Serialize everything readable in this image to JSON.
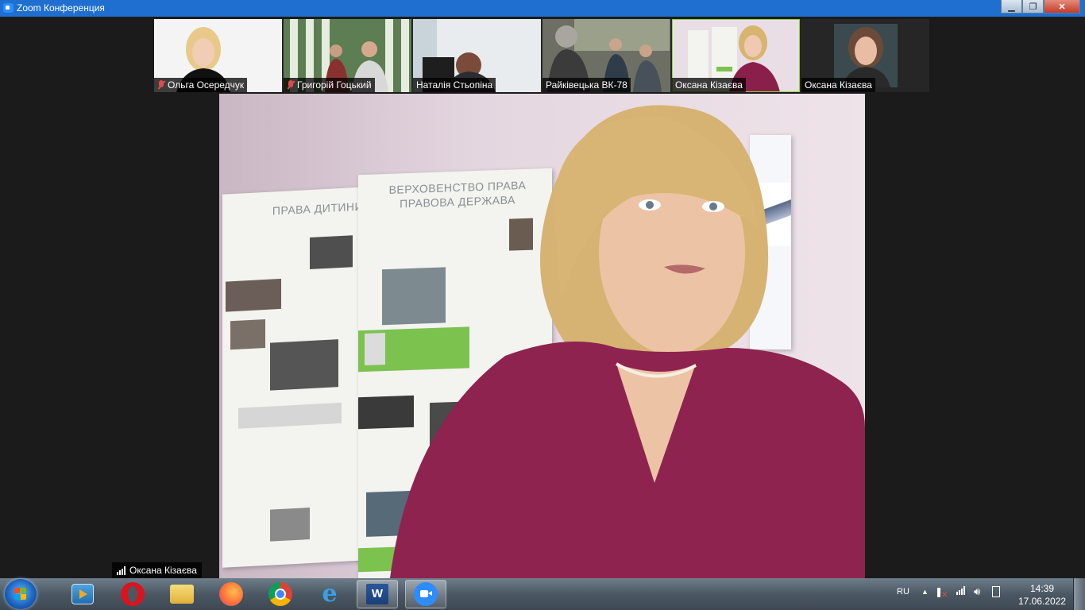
{
  "window": {
    "title": "Zoom Конференция"
  },
  "gallery": [
    {
      "name": "Ольга Осередчук",
      "muted": true
    },
    {
      "name": "Григорій Гоцький",
      "muted": true
    },
    {
      "name": "Наталія Стьопіна",
      "muted": false
    },
    {
      "name": "Райківецька ВК-78",
      "muted": false
    },
    {
      "name": "Оксана Кізаєва",
      "muted": false,
      "active": true
    },
    {
      "name": "Оксана Кізаєва",
      "muted": false
    }
  ],
  "main_video": {
    "speaker_name": "Оксана Кізаєва",
    "poster_left_title": "ПРАВА ДИТИНИ",
    "poster_right_title_1": "ВЕРХОВЕНСТВО ПРАВА",
    "poster_right_title_2": "ПРАВОВА ДЕРЖАВА"
  },
  "taskbar": {
    "apps": [
      "media-player",
      "opera",
      "file-explorer",
      "firefox",
      "chrome",
      "internet-explorer",
      "word",
      "zoom"
    ],
    "language": "RU",
    "time": "14:39",
    "date": "17.06.2022"
  },
  "colors": {
    "titlebar": "#1e6fd0",
    "accent_active": "#8bd63a",
    "muted_icon": "#e04a4a"
  }
}
